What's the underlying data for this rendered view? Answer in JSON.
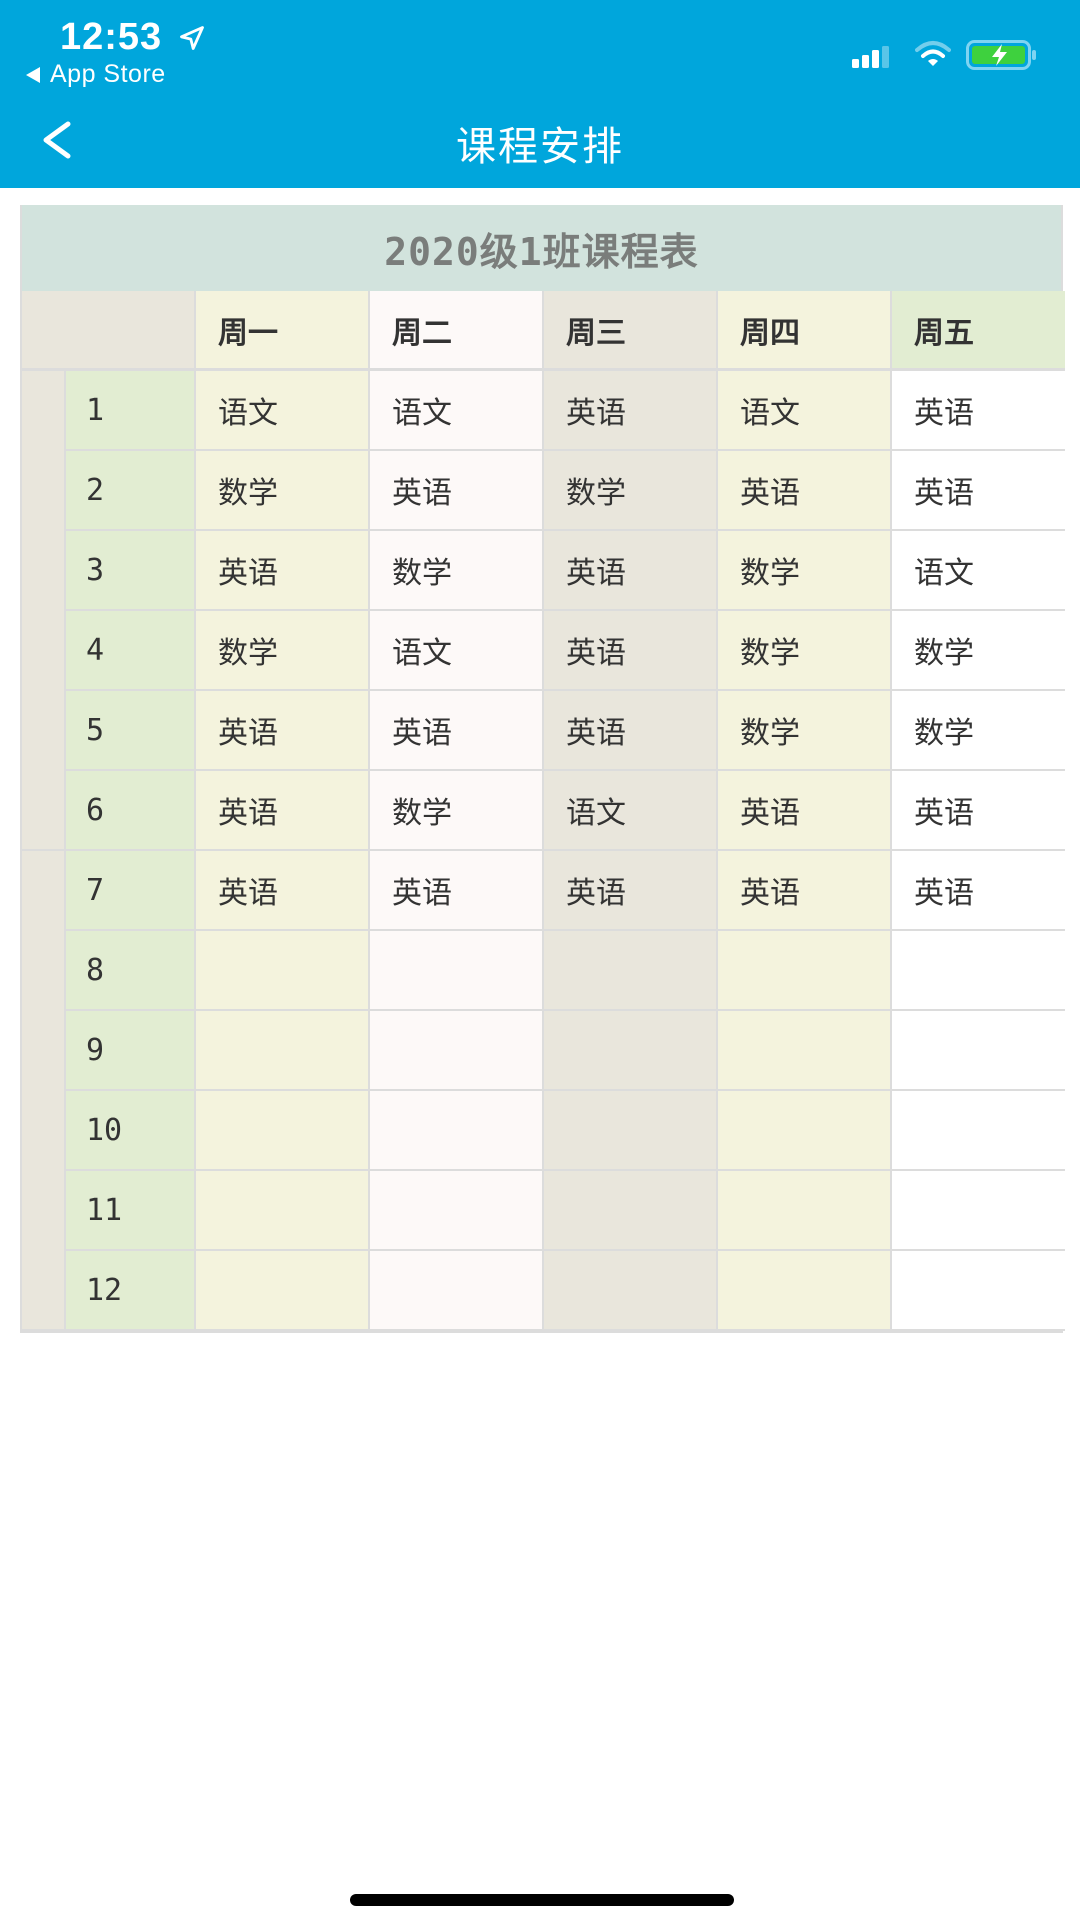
{
  "status_bar": {
    "time": "12:53",
    "back_app_label": "App Store",
    "icons": [
      "location-arrow-icon",
      "cellular-signal-icon",
      "wifi-icon",
      "battery-charging-icon"
    ]
  },
  "nav": {
    "title": "课程安排",
    "back_icon": "chevron-left-icon"
  },
  "colors": {
    "brand": "#00a6dc",
    "battery_fill": "#3ed13e"
  },
  "timetable": {
    "title": "2020级1班课程表",
    "days": [
      "周一",
      "周二",
      "周三",
      "周四",
      "周五"
    ],
    "sections": [
      "",
      ""
    ],
    "rows": [
      {
        "period": "1",
        "classes": [
          "语文",
          "语文",
          "英语",
          "语文",
          "英语"
        ]
      },
      {
        "period": "2",
        "classes": [
          "数学",
          "英语",
          "数学",
          "英语",
          "英语"
        ]
      },
      {
        "period": "3",
        "classes": [
          "英语",
          "数学",
          "英语",
          "数学",
          "语文"
        ]
      },
      {
        "period": "4",
        "classes": [
          "数学",
          "语文",
          "英语",
          "数学",
          "数学"
        ]
      },
      {
        "period": "5",
        "classes": [
          "英语",
          "英语",
          "英语",
          "数学",
          "数学"
        ]
      },
      {
        "period": "6",
        "classes": [
          "英语",
          "数学",
          "语文",
          "英语",
          "英语"
        ]
      },
      {
        "period": "7",
        "classes": [
          "英语",
          "英语",
          "英语",
          "英语",
          "英语"
        ]
      },
      {
        "period": "8",
        "classes": [
          "",
          "",
          "",
          "",
          ""
        ]
      },
      {
        "period": "9",
        "classes": [
          "",
          "",
          "",
          "",
          ""
        ]
      },
      {
        "period": "10",
        "classes": [
          "",
          "",
          "",
          "",
          ""
        ]
      },
      {
        "period": "11",
        "classes": [
          "",
          "",
          "",
          "",
          ""
        ]
      },
      {
        "period": "12",
        "classes": [
          "",
          "",
          "",
          "",
          ""
        ]
      }
    ]
  }
}
